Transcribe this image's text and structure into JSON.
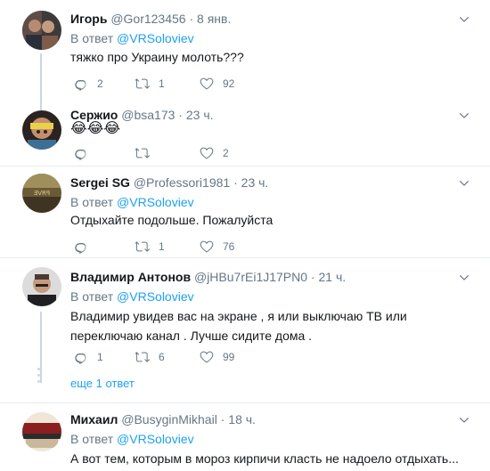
{
  "tweets": [
    {
      "name": "Игорь",
      "handle": "@Gor123456",
      "time": "8 янв.",
      "reply_prefix": "В ответ ",
      "reply_to": "@VRSoloviev",
      "text": "тяжко про Украину молоть???",
      "replies": "2",
      "retweets": "1",
      "likes": "92"
    },
    {
      "name": "Сержио",
      "handle": "@bsa173",
      "time": "23 ч.",
      "text": "😂😂😂",
      "replies": "",
      "retweets": "",
      "likes": "2"
    },
    {
      "name": "Sergei SG",
      "handle": "@Professori1981",
      "time": "23 ч.",
      "reply_prefix": "В ответ ",
      "reply_to": "@VRSoloviev",
      "text": "Отдыхайте подольше. Пожалуйста",
      "replies": "",
      "retweets": "1",
      "likes": "76"
    },
    {
      "name": "Владимир Антонов",
      "handle": "@jHBu7rEi1J17PN0",
      "time": "21 ч.",
      "reply_prefix": "В ответ ",
      "reply_to": "@VRSoloviev",
      "text": "Владимир увидев вас на экране , я или выключаю ТВ или переключаю канал . Лучше сидите дома .",
      "replies": "1",
      "retweets": "6",
      "likes": "99",
      "more_replies": "еще 1 ответ"
    },
    {
      "name": "Михаил",
      "handle": "@BusyginMikhail",
      "time": "18 ч.",
      "reply_prefix": "В ответ ",
      "reply_to": "@VRSoloviev",
      "text": "А вот тем, которым в мороз кирпичи класть не надоело отдыхать..."
    }
  ],
  "colors": {
    "link": "#1da1f2",
    "muted": "#657786",
    "separator": "#e6ecf0",
    "thread_line": "#ccd6dd"
  },
  "icons": [
    "reply-icon",
    "retweet-icon",
    "like-icon",
    "chevron-down-icon"
  ]
}
